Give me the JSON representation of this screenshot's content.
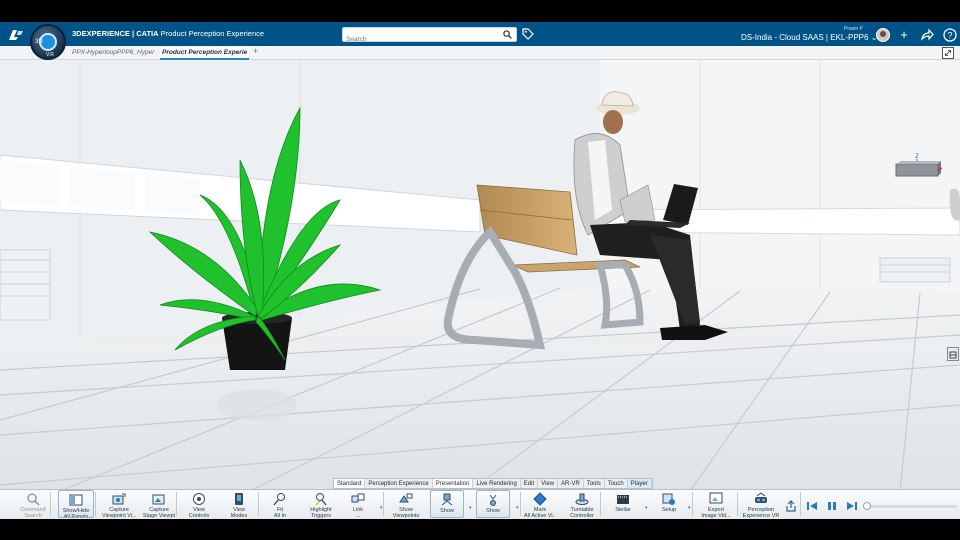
{
  "header": {
    "brand_logo_text": "3DS",
    "compass_label": "3D",
    "compass_version": "V.R",
    "app_title_bold": "3DEXPERIENCE | CATIA",
    "app_title_rest": "Product Perception Experience",
    "search_placeholder": "Search",
    "tenant": "DS-India - Cloud SAAS | EKL-PPP6",
    "user_name": "Pravin P",
    "accent_color": "#005386"
  },
  "tabs": [
    {
      "label": "PPX-HyperloopPPP6_Hyper",
      "active": false
    },
    {
      "label": "Product Perception Experie",
      "active": true
    }
  ],
  "section_tabs": [
    {
      "label": "Standard",
      "state": "selected"
    },
    {
      "label": "Perception Experience",
      "state": "normal"
    },
    {
      "label": "Presentation",
      "state": "selected"
    },
    {
      "label": "Live Rendering",
      "state": "normal"
    },
    {
      "label": "Edit",
      "state": "normal"
    },
    {
      "label": "View",
      "state": "normal"
    },
    {
      "label": "AR-VR",
      "state": "normal"
    },
    {
      "label": "Tools",
      "state": "normal"
    },
    {
      "label": "Touch",
      "state": "normal"
    },
    {
      "label": "Player",
      "state": "highlight"
    }
  ],
  "commands": [
    {
      "label": "Command\nSearch",
      "icon": "search-icon"
    },
    {
      "label": "Show/Hide\nAll Panels",
      "icon": "panels-icon"
    },
    {
      "label": "Capture\nViewpoint Vi...",
      "icon": "capture-viewpoint-icon"
    },
    {
      "label": "Capture\nStage Viewpt",
      "icon": "capture-stage-icon"
    },
    {
      "label": "View\nControls",
      "icon": "view-controls-icon"
    },
    {
      "label": "View\nModes",
      "icon": "view-modes-icon"
    },
    {
      "label": "Fit\nAll In",
      "icon": "fit-all-icon"
    },
    {
      "label": "Highlight\nTriggers",
      "icon": "highlight-icon"
    },
    {
      "label": "Link\n...",
      "icon": "link-icon"
    },
    {
      "label": "Show\nViewpoints",
      "icon": "viewpoints-icon"
    },
    {
      "label": "Show",
      "icon": "show-icon"
    },
    {
      "label": "Show\n...",
      "icon": "show-alt-icon"
    },
    {
      "label": "Mark\nAll Active Vi...",
      "icon": "mark-icon"
    },
    {
      "label": "Turntable\nController",
      "icon": "turntable-icon"
    },
    {
      "label": "Stellar",
      "icon": "stellar-icon"
    },
    {
      "label": "Setup",
      "icon": "setup-icon"
    },
    {
      "label": "Export\nImage Vid...",
      "icon": "export-icon"
    },
    {
      "label": "Perception\nExperience VR",
      "icon": "vr-icon"
    }
  ],
  "compass_axis_label": "Z"
}
